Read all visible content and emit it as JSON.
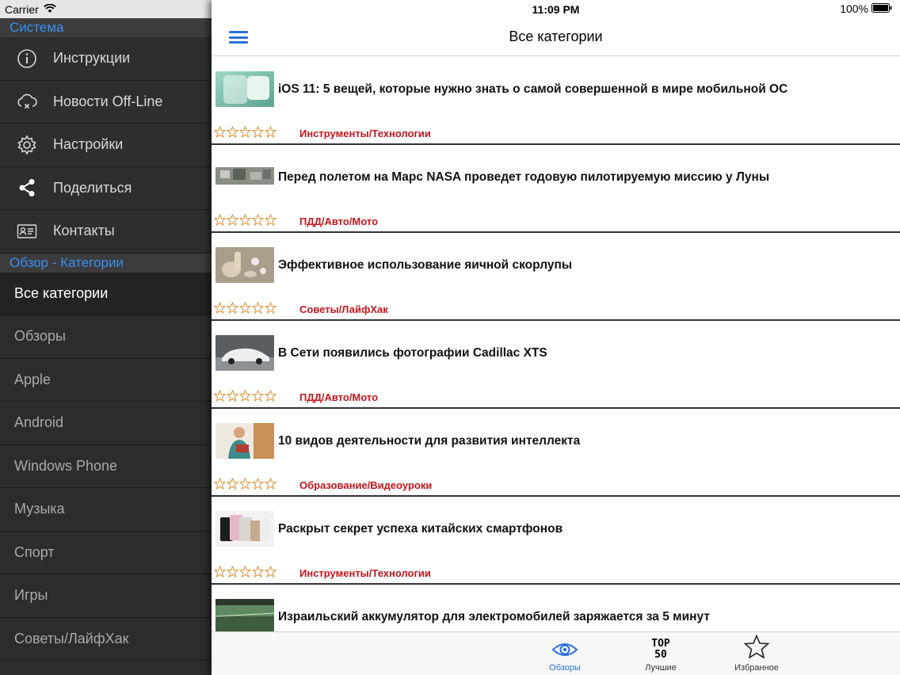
{
  "sidebar": {
    "status": {
      "carrier": "Carrier"
    },
    "system_header": "Система",
    "system_items": [
      {
        "label": "Инструкции",
        "icon": "info-icon"
      },
      {
        "label": "Новости Off-Line",
        "icon": "cloud-offline-icon"
      },
      {
        "label": "Настройки",
        "icon": "gear-icon"
      },
      {
        "label": "Поделиться",
        "icon": "share-icon"
      },
      {
        "label": "Контакты",
        "icon": "contact-card-icon"
      }
    ],
    "categories_header": "Обзор - Категории",
    "categories": [
      {
        "label": "Все категории",
        "active": true
      },
      {
        "label": "Обзоры"
      },
      {
        "label": "Apple"
      },
      {
        "label": "Android"
      },
      {
        "label": "Windows Phone"
      },
      {
        "label": "Музыка"
      },
      {
        "label": "Спорт"
      },
      {
        "label": "Игры"
      },
      {
        "label": "Советы/ЛайфХак"
      }
    ]
  },
  "main": {
    "status": {
      "time": "11:09 PM",
      "battery": "100%"
    },
    "title": "Все категории",
    "articles": [
      {
        "title": "iOS 11: 5 вещей, которые нужно знать о самой совершенной в мире мобильной ОС",
        "category": "Инструменты/Технологии",
        "rating": 0
      },
      {
        "title": "Перед полетом на Марс NASA проведет годовую пилотируемую миссию у Луны",
        "category": "ПДД/Авто/Мото",
        "rating": 0
      },
      {
        "title": "Эффективное использование яичной скорлупы",
        "category": "Советы/ЛайфХак",
        "rating": 0
      },
      {
        "title": "В Сети появились фотографии Cadillac XTS",
        "category": "ПДД/Авто/Мото",
        "rating": 0
      },
      {
        "title": "10 видов деятельности для развития интеллекта",
        "category": "Образование/Видеоуроки",
        "rating": 0
      },
      {
        "title": "Раскрыт секрет успеха китайских смартфонов",
        "category": "Инструменты/Технологии",
        "rating": 0
      },
      {
        "title": "Израильский аккумулятор для электромобилей заряжается за 5 минут",
        "category": "",
        "rating": 0
      }
    ],
    "tabs": [
      {
        "label": "Обзоры",
        "icon": "eye-icon",
        "active": true
      },
      {
        "label": "Лучшие",
        "icon": "top50-icon",
        "icon_text": [
          "TOP",
          "50"
        ]
      },
      {
        "label": "Избранное",
        "icon": "star-icon"
      }
    ],
    "colors": {
      "accent": "#2a6fd6",
      "category": "#c4161c",
      "star_outline": "#e08a2c",
      "header_blue": "#3b8ff0"
    }
  }
}
